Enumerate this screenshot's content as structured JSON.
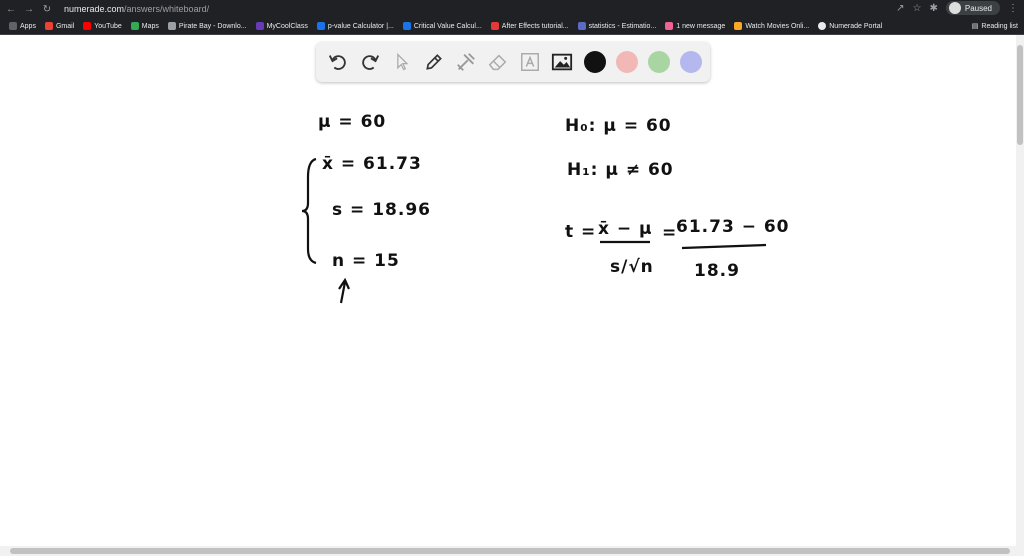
{
  "browser": {
    "url_host": "numerade.com",
    "url_path": "/answers/whiteboard/",
    "profile_status": "Paused",
    "bookmarks": [
      {
        "label": "Apps",
        "color": "#5f6368"
      },
      {
        "label": "Gmail",
        "color": "#ea4335"
      },
      {
        "label": "YouTube",
        "color": "#ff0000"
      },
      {
        "label": "Maps",
        "color": "#34a853"
      },
      {
        "label": "Pirate Bay - Downlo...",
        "color": "#9aa0a6"
      },
      {
        "label": "MyCoolClass",
        "color": "#673ab7"
      },
      {
        "label": "p-value Calculator |...",
        "color": "#1a73e8"
      },
      {
        "label": "Critical Value Calcul...",
        "color": "#1a73e8"
      },
      {
        "label": "After Effects tutorial...",
        "color": "#e53935"
      },
      {
        "label": "statistics - Estimatio...",
        "color": "#5c6bc0"
      },
      {
        "label": "1 new message",
        "color": "#f06292"
      },
      {
        "label": "Watch Movies Onli...",
        "color": "#f9a825"
      },
      {
        "label": "Numerade Portal",
        "color": "#e8eaed"
      }
    ],
    "reading_list": "Reading list"
  },
  "toolbar": {
    "colors": [
      "#111111",
      "#f2b8b5",
      "#a8d5a2",
      "#b4b8ee"
    ]
  },
  "whiteboard": {
    "mu": "μ = 60",
    "xbar": "x̄ = 61.73",
    "s": "s = 18.96",
    "n": "n = 15",
    "h0": "H₀: μ = 60",
    "h1": "H₁: μ ≠ 60",
    "t_eq": "t =",
    "t_num": "x̄ − μ",
    "t_den": "s/√n",
    "eq2": "=",
    "sub_num": "61.73 − 60",
    "sub_den": "18.9"
  }
}
